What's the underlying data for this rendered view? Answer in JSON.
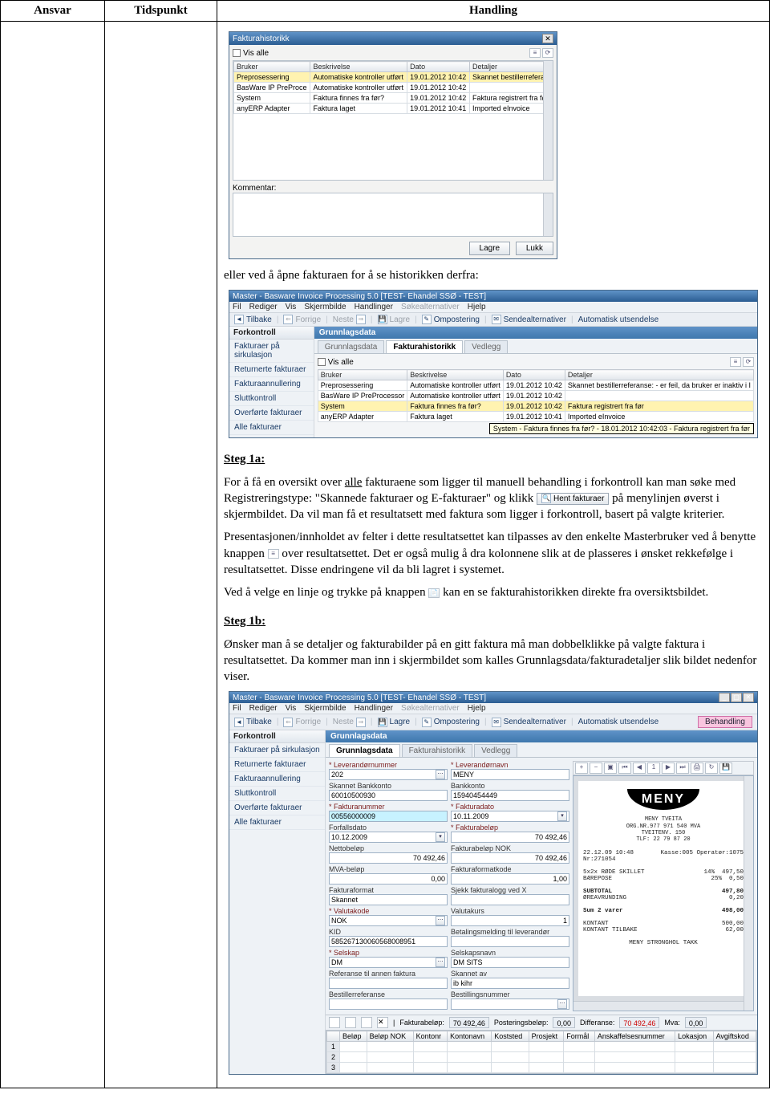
{
  "header": {
    "ansvar": "Ansvar",
    "tidspunkt": "Tidspunkt",
    "handling": "Handling"
  },
  "dlg1": {
    "title": "Fakturahistorikk",
    "vis_alle": "Vis alle",
    "cols": {
      "bruker": "Bruker",
      "beskrivelse": "Beskrivelse",
      "dato": "Dato",
      "detaljer": "Detaljer"
    },
    "rows": [
      {
        "bruker": "Preprosessering",
        "beskrivelse": "Automatiske kontroller utført",
        "dato": "19.01.2012 10:42",
        "detaljer": "Skannet bestillerreferar"
      },
      {
        "bruker": "BasWare IP PreProce",
        "beskrivelse": "Automatiske kontroller utført",
        "dato": "19.01.2012 10:42",
        "detaljer": ""
      },
      {
        "bruker": "System",
        "beskrivelse": "Faktura finnes fra før?",
        "dato": "19.01.2012 10:42",
        "detaljer": "Faktura registrert fra før"
      },
      {
        "bruker": "anyERP Adapter",
        "beskrivelse": "Faktura laget",
        "dato": "19.01.2012 10:41",
        "detaljer": "Imported eInvoice"
      }
    ],
    "kommentar": "Kommentar:",
    "lagre": "Lagre",
    "lukk": "Lukk"
  },
  "para1": "eller ved å åpne fakturaen for å se historikken derfra:",
  "app": {
    "title": "Master - Basware Invoice Processing 5.0 [TEST- Ehandel SSØ - TEST]",
    "menu": {
      "fil": "Fil",
      "rediger": "Rediger",
      "vis": "Vis",
      "skjermbilde": "Skjermbilde",
      "handlinger": "Handlinger",
      "sokealternativer": "Søkealternativer",
      "hjelp": "Hjelp"
    },
    "toolbar": {
      "tilbake": "Tilbake",
      "forrige": "Forrige",
      "neste": "Neste",
      "lagre": "Lagre",
      "ompostering": "Ompostering",
      "sendealternativer": "Sendealternativer",
      "automatisk": "Automatisk utsendelse",
      "behandling": "Behandling"
    },
    "sidebar": {
      "title": "Forkontroll",
      "items": [
        "Fakturaer på sirkulasjon",
        "Returnerte fakturaer",
        "Fakturaannullering",
        "Sluttkontroll",
        "Overførte fakturaer",
        "Alle fakturaer"
      ]
    },
    "tabbox": "Grunnlagsdata",
    "tabs": {
      "grunnlagsdata": "Grunnlagsdata",
      "fakturahistorikk": "Fakturahistorikk",
      "vedlegg": "Vedlegg"
    },
    "hist_rows": [
      {
        "bruker": "Preprosessering",
        "beskrivelse": "Automatiske kontroller utført",
        "dato": "19.01.2012 10:42",
        "detaljer": "Skannet bestillerreferanse: - er feil, da bruker er inaktiv i I"
      },
      {
        "bruker": "BasWare IP PreProcessor",
        "beskrivelse": "Automatiske kontroller utført",
        "dato": "19.01.2012 10:42",
        "detaljer": ""
      },
      {
        "bruker": "System",
        "beskrivelse": "Faktura finnes fra før?",
        "dato": "19.01.2012 10:42",
        "detaljer": "Faktura registrert fra før"
      },
      {
        "bruker": "anyERP Adapter",
        "beskrivelse": "Faktura laget",
        "dato": "19.01.2012 10:41",
        "detaljer": "Imported eInvoice"
      }
    ],
    "tooltip": "System - Faktura finnes fra før? - 18.01.2012 10:42:03 - Faktura registrert fra før"
  },
  "steg1a": {
    "head": "Steg 1a:",
    "p1a": "For å få en oversikt over ",
    "alle": "alle",
    "p1b": " fakturaene som ligger til manuell behandling i forkontroll kan man søke med Registreringstype: \"Skannede fakturaer og E-fakturaer\" og klikk ",
    "hent": "Hent fakturaer",
    "p1c": " på menylinjen øverst i skjermbildet. Da vil man få et resultatsett med faktura som ligger i forkontroll, basert på valgte kriterier.",
    "p2a": "Presentasjonen/innholdet av felter i dette resultatsettet kan tilpasses av den enkelte Masterbruker ved å benytte knappen ",
    "p2b": " over resultatsettet. Det er også mulig å dra kolonnene slik at de plasseres i ønsket rekkefølge i resultatsettet. Disse endringene vil da bli lagret i systemet.",
    "p3a": "Ved å velge en linje og trykke på knappen ",
    "p3b": " kan en se fakturahistorikken direkte fra oversiktsbildet."
  },
  "steg1b": {
    "head": "Steg 1b:",
    "p1": "Ønsker man å se detaljer og fakturabilder på en gitt faktura må man dobbelklikke på valgte faktura i resultatsettet. Da kommer man inn i skjermbildet som kalles Grunnlagsdata/fakturadetaljer slik bildet nedenfor viser."
  },
  "form": {
    "labels": {
      "levnr": "* Leverandørnummer",
      "levnavn": "* Leverandørnavn",
      "skbank": "Skannet Bankkonto",
      "bank": "Bankkonto",
      "faktnr": "* Fakturanummer",
      "faktdato": "* Fakturadato",
      "forfall": "Forfallsdato",
      "faktbel": "* Fakturabeløp",
      "netto": "Nettobeløp",
      "faktnok": "Fakturabeløp NOK",
      "mva": "MVA-beløp",
      "formkode": "Fakturaformatkode",
      "fformat": "Fakturaformat",
      "sjekk": "Sjekk fakturalogg ved X",
      "valkode": "* Valutakode",
      "valkurs": "Valutakurs",
      "kid": "KID",
      "betmeld": "Betalingsmelding til leverandør",
      "selskap": "* Selskap",
      "selskapnavn": "Selskapsnavn",
      "refannen": "Referanse til annen faktura",
      "skannetav": "Skannet av",
      "bestillref": "Bestillerreferanse",
      "bestillnr": "Bestillingsnummer"
    },
    "values": {
      "levnr": "202",
      "levnavn": "MENY",
      "skbank": "60010500930",
      "bank": "15940454449",
      "faktnr": "00556000009",
      "faktdato": "10.11.2009",
      "forfall": "10.12.2009",
      "faktbel": "70 492,46",
      "netto": "70 492,46",
      "faktnok": "70 492,46",
      "mva": "0,00",
      "formkode": "1,00",
      "fformat": "Skannet",
      "sjekk": "",
      "valkode": "NOK",
      "valkurs": "1",
      "kid": "585267130060568008951",
      "betmeld": "",
      "selskap": "DM",
      "selskapnavn": "DM SITS",
      "refannen": "",
      "skannetav": "ib kihr",
      "bestillref": "",
      "bestillnr": ""
    }
  },
  "invoice": {
    "logo": "MENY",
    "addr1": "MENY TVEITA",
    "addr2": "ORG.NR.977 971 540 MVA",
    "addr3": "TVEITENV. 150",
    "addr4": "TLF: 22 79 87 20",
    "dt": "22.12.09 10:48",
    "bong": "Kasse:005  Operatør:1075",
    "nr": "Nr:271054",
    "lines": [
      {
        "l": "5x2x RØDE SKILLET",
        "m": "14%",
        "r": "497,50"
      },
      {
        "l": "BÆREPOSE",
        "m": "25%",
        "r": "0,50"
      },
      {
        "l": "SUBTOTAL",
        "m": "",
        "r": "497,80"
      },
      {
        "l": "ØREAVRUNDING",
        "m": "",
        "r": "0,20"
      },
      {
        "l": "Sum 2 varer",
        "m": "",
        "r": "498,00"
      },
      {
        "l": "KONTANT",
        "m": "",
        "r": "500,00"
      },
      {
        "l": "KONTANT TILBAKE",
        "m": "",
        "r": "62,00"
      }
    ],
    "thanks": "MENY STRONGHOL TAKK"
  },
  "bottombar": {
    "fakturabelop": "Fakturabeløp:",
    "fakturabelop_v": "70 492,46",
    "postering": "Posteringsbeløp:",
    "postering_v": "0,00",
    "differanse": "Differanse:",
    "differanse_v": "70 492,46",
    "mva": "Mva:",
    "mva_v": "0,00"
  },
  "bottomgrid": {
    "cols": [
      "Beløp",
      "Beløp NOK",
      "Kontonr",
      "Kontonavn",
      "Koststed",
      "Prosjekt",
      "Formål",
      "Anskaffelsesnummer",
      "Lokasjon",
      "Avgiftskod"
    ]
  }
}
